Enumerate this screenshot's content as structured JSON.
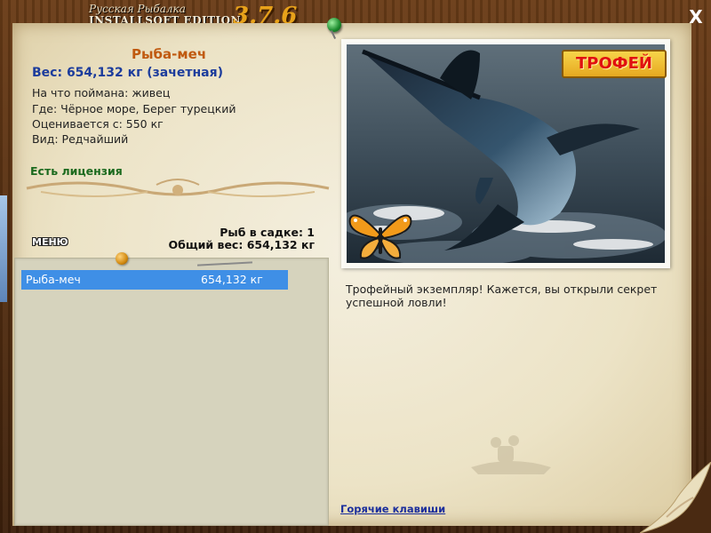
{
  "window": {
    "title_sub": "Русская Рыбалка",
    "title_main": "INSTALLSOFT EDITION",
    "version": "3.7.6",
    "close_label": "X"
  },
  "fish": {
    "name": "Рыба-меч",
    "weight_line": "Вес: 654,132 кг (зачетная)",
    "bait_line": "На что поймана: живец",
    "location_line": "Где: Чёрное море, Берег турецкий",
    "value_line": "Оценивается с: 550 кг",
    "kind_line": "Вид: Редчайший",
    "license": "Есть лицензия"
  },
  "keepnet": {
    "count_line": "Рыб в садке: 1",
    "total_line": "Общий вес: 654,132 кг",
    "items": [
      {
        "name": "Рыба-меч",
        "weight": "654,132 кг"
      }
    ]
  },
  "menu": {
    "label": "МЕНЮ"
  },
  "photo": {
    "badge": "ТРОФЕЙ",
    "description": "Трофейный экземпляр! Кажется, вы открыли секрет успешной ловли!"
  },
  "footer": {
    "hotkeys": "Горячие клавиши"
  },
  "colors": {
    "fish_name": "#c05a10",
    "weight": "#1c3c9c",
    "license": "#1b6a1e",
    "selection": "#3f8fe6",
    "link": "#1c2f9c"
  }
}
